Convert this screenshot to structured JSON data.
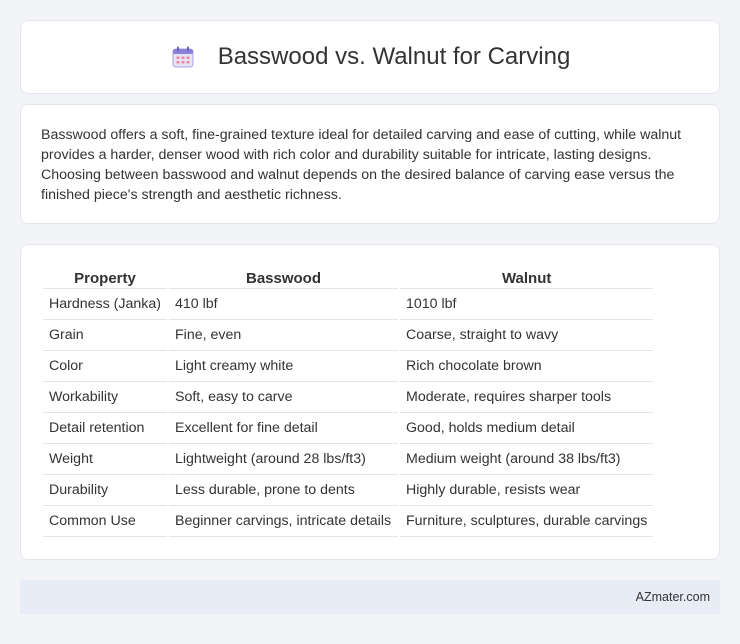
{
  "header": {
    "title": "Basswood vs. Walnut for Carving",
    "icon": "calendar-icon"
  },
  "intro": {
    "text": "Basswood offers a soft, fine-grained texture ideal for detailed carving and ease of cutting, while walnut provides a harder, denser wood with rich color and durability suitable for intricate, lasting designs. Choosing between basswood and walnut depends on the desired balance of carving ease versus the finished piece's strength and aesthetic richness."
  },
  "table": {
    "headers": [
      "Property",
      "Basswood",
      "Walnut"
    ],
    "rows": [
      [
        "Hardness (Janka)",
        "410 lbf",
        "1010 lbf"
      ],
      [
        "Grain",
        "Fine, even",
        "Coarse, straight to wavy"
      ],
      [
        "Color",
        "Light creamy white",
        "Rich chocolate brown"
      ],
      [
        "Workability",
        "Soft, easy to carve",
        "Moderate, requires sharper tools"
      ],
      [
        "Detail retention",
        "Excellent for fine detail",
        "Good, holds medium detail"
      ],
      [
        "Weight",
        "Lightweight (around 28 lbs/ft3)",
        "Medium weight (around 38 lbs/ft3)"
      ],
      [
        "Durability",
        "Less durable, prone to dents",
        "Highly durable, resists wear"
      ],
      [
        "Common Use",
        "Beginner carvings, intricate details",
        "Furniture, sculptures, durable carvings"
      ]
    ]
  },
  "footer": {
    "brand": "AZmater.com"
  }
}
